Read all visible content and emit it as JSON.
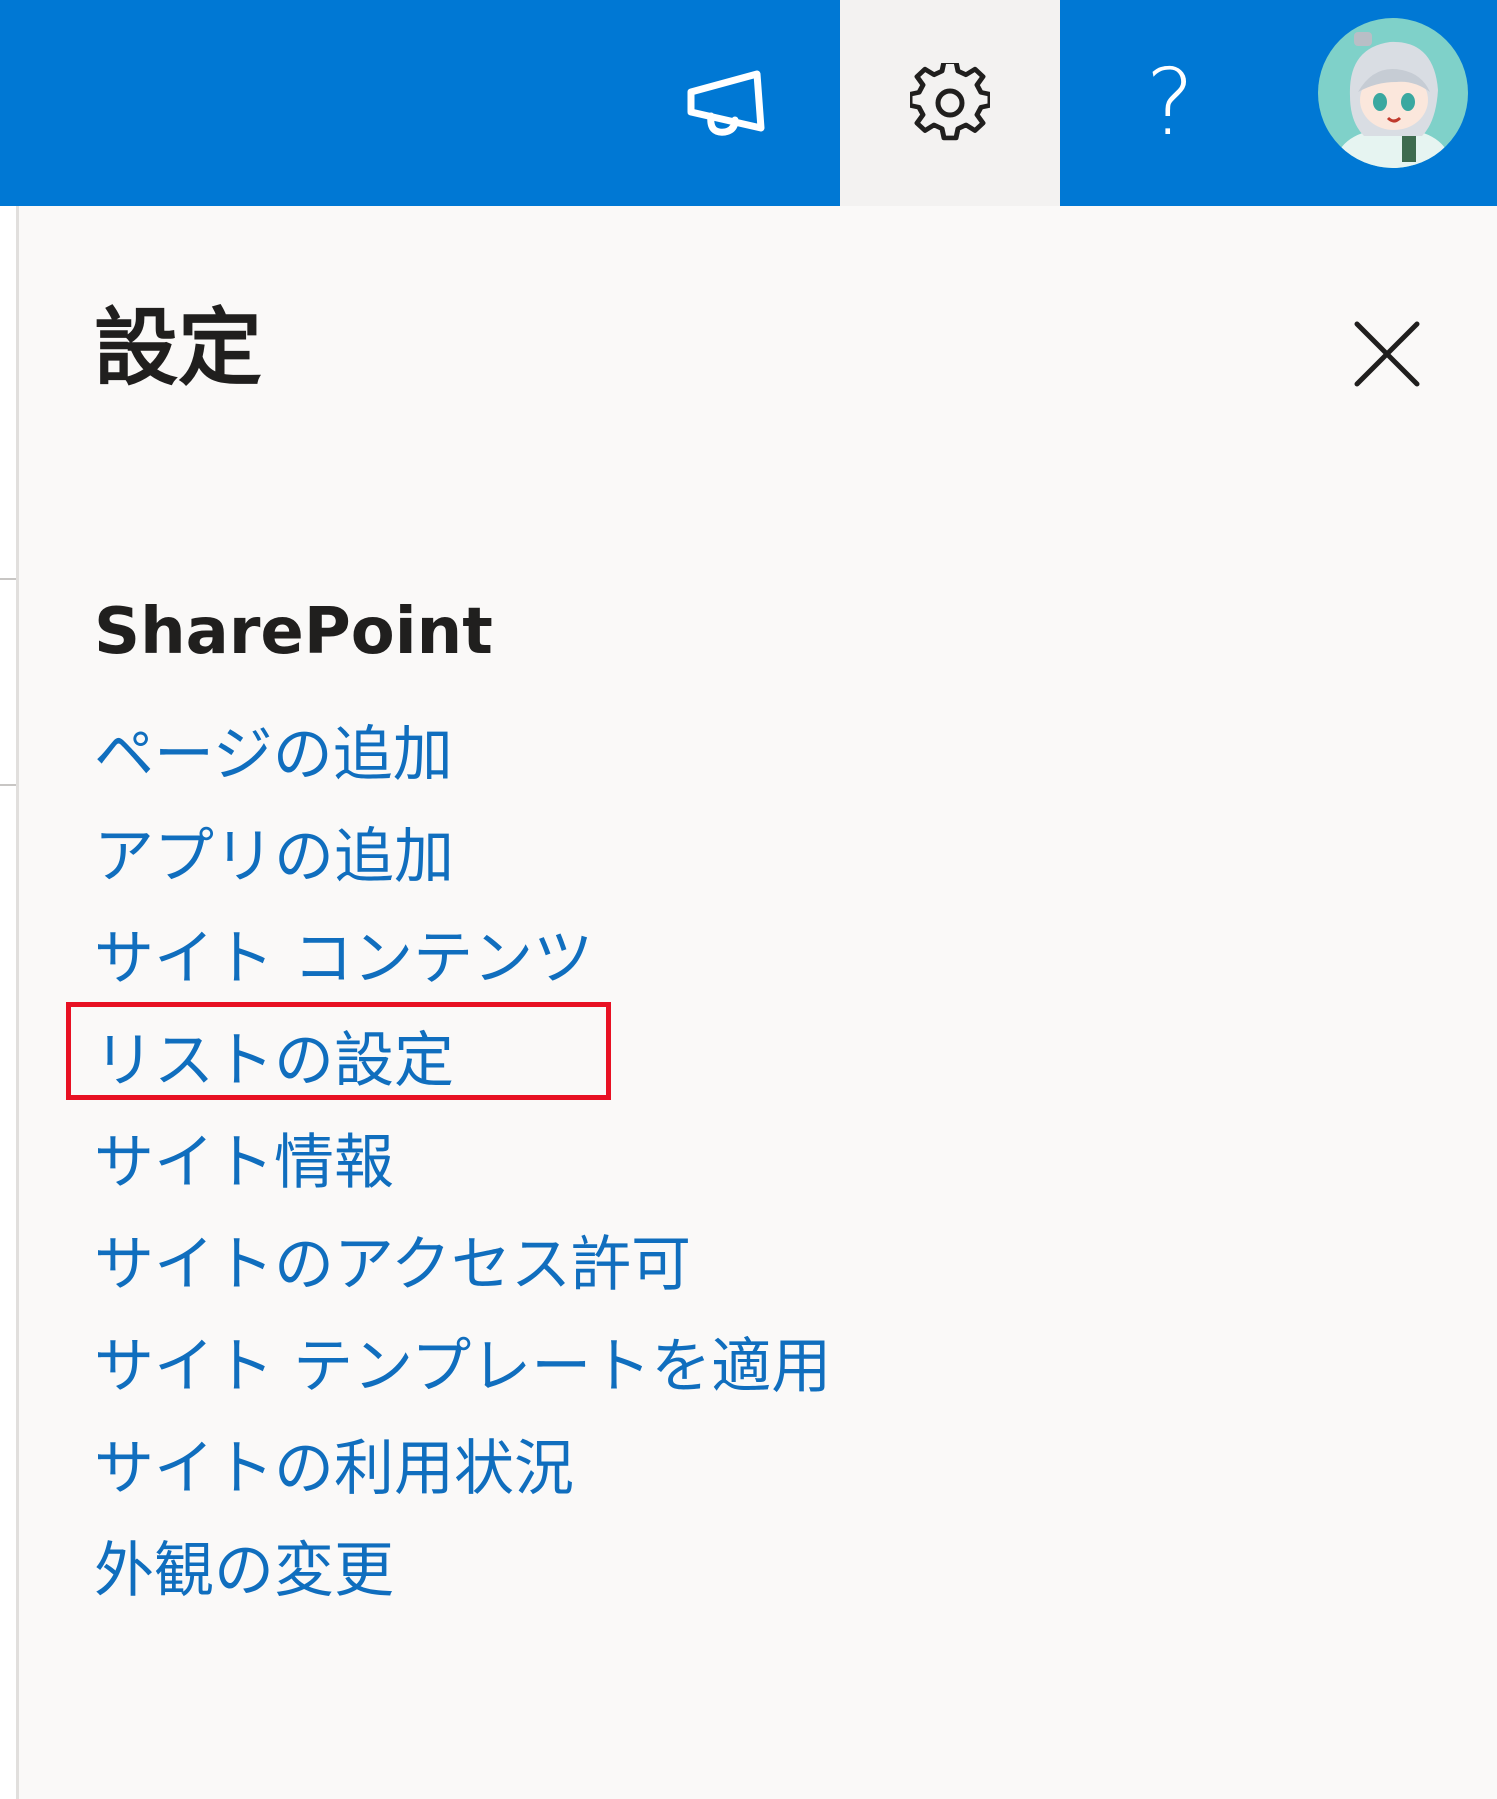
{
  "topbar": {
    "accent_color": "#0078d4",
    "buttons": [
      {
        "name": "announcement",
        "icon": "megaphone-icon"
      },
      {
        "name": "settings",
        "icon": "gear-icon",
        "active": true
      },
      {
        "name": "help",
        "icon": "help-icon",
        "glyph": "?"
      },
      {
        "name": "account",
        "icon": "avatar"
      }
    ]
  },
  "panel": {
    "title": "設定",
    "close_icon": "close-icon",
    "section_title": "SharePoint",
    "link_color": "#106ebe",
    "items": [
      {
        "label": "ページの追加"
      },
      {
        "label": "アプリの追加"
      },
      {
        "label": "サイト コンテンツ"
      },
      {
        "label": "リストの設定",
        "highlighted": true
      },
      {
        "label": "サイト情報"
      },
      {
        "label": "サイトのアクセス許可"
      },
      {
        "label": "サイト テンプレートを適用"
      },
      {
        "label": "サイトの利用状況"
      },
      {
        "label": "外観の変更"
      }
    ]
  },
  "annotation": {
    "highlight_color": "#e81123"
  }
}
